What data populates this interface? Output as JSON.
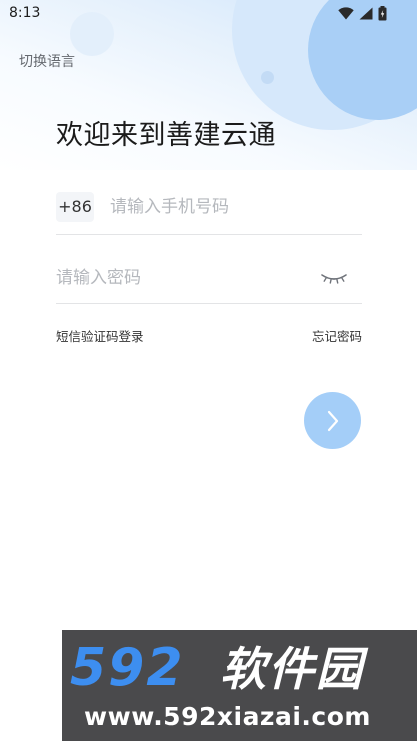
{
  "status_bar": {
    "time": "8:13",
    "icons": [
      "wifi-icon",
      "signal-icon",
      "battery-icon"
    ]
  },
  "header": {
    "language_switch": "切换语言",
    "welcome_title": "欢迎来到善建云通"
  },
  "login_form": {
    "country_code": "+86",
    "phone_placeholder": "请输入手机号码",
    "password_placeholder": "请输入密码",
    "password_visibility_icon": "eye-closed-icon",
    "sms_login_label": "短信验证码登录",
    "forgot_password_label": "忘记密码",
    "next_icon": "chevron-right-icon"
  },
  "watermark": {
    "logo_number": "592",
    "logo_text": "软件园",
    "url": "www.592xiazai.com"
  },
  "colors": {
    "accent": "#a4cef8",
    "title_text": "#1b1b1b",
    "placeholder_text": "#b5b8bd",
    "watermark_bg": "#4a4a4c",
    "watermark_logo_blue": "#3d8ef0"
  }
}
